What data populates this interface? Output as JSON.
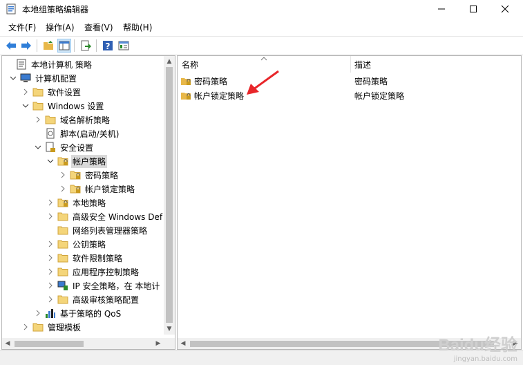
{
  "window": {
    "title": "本地组策略编辑器"
  },
  "menu": [
    "文件(F)",
    "操作(A)",
    "查看(V)",
    "帮助(H)"
  ],
  "toolbar": [
    "back-icon",
    "forward-icon",
    "up-folder-icon",
    "show-tree-icon",
    "export-icon",
    "help-icon",
    "properties-icon"
  ],
  "tree": [
    {
      "label": "本地计算机 策略",
      "icon": "policy-doc-icon",
      "arrow": ""
    },
    {
      "label": "计算机配置",
      "icon": "computer-icon",
      "arrow": "open"
    },
    {
      "label": "软件设置",
      "icon": "folder-icon",
      "arrow": "closed"
    },
    {
      "label": "Windows 设置",
      "icon": "folder-icon",
      "arrow": "open"
    },
    {
      "label": "域名解析策略",
      "icon": "folder-icon",
      "arrow": "closed"
    },
    {
      "label": "脚本(启动/关机)",
      "icon": "script-icon",
      "arrow": ""
    },
    {
      "label": "安全设置",
      "icon": "security-icon",
      "arrow": "open"
    },
    {
      "label": "帐户策略",
      "icon": "locked-folder-icon",
      "arrow": "open",
      "selected": true
    },
    {
      "label": "密码策略",
      "icon": "locked-folder-icon",
      "arrow": "closed"
    },
    {
      "label": "帐户锁定策略",
      "icon": "locked-folder-icon",
      "arrow": "closed"
    },
    {
      "label": "本地策略",
      "icon": "locked-folder-icon",
      "arrow": "closed"
    },
    {
      "label": "高级安全 Windows Def",
      "icon": "folder-icon",
      "arrow": "closed"
    },
    {
      "label": "网络列表管理器策略",
      "icon": "folder-icon",
      "arrow": ""
    },
    {
      "label": "公钥策略",
      "icon": "folder-icon",
      "arrow": "closed"
    },
    {
      "label": "软件限制策略",
      "icon": "folder-icon",
      "arrow": "closed"
    },
    {
      "label": "应用程序控制策略",
      "icon": "folder-icon",
      "arrow": "closed"
    },
    {
      "label": "IP 安全策略，在 本地计",
      "icon": "ipsec-icon",
      "arrow": "closed"
    },
    {
      "label": "高级审核策略配置",
      "icon": "folder-icon",
      "arrow": "closed"
    },
    {
      "label": "基于策略的 QoS",
      "icon": "qos-chart-icon",
      "arrow": "closed"
    },
    {
      "label": "管理模板",
      "icon": "folder-icon",
      "arrow": "closed"
    }
  ],
  "list": {
    "columns": [
      "名称",
      "描述"
    ],
    "rows": [
      {
        "name": "密码策略",
        "desc": "密码策略"
      },
      {
        "name": "帐户锁定策略",
        "desc": "帐户锁定策略"
      }
    ]
  },
  "watermark": {
    "brand": "Baidu经验",
    "url": "jingyan.baidu.com"
  },
  "colors": {
    "accent": "#1a6fc9",
    "folder": "#e8b84a",
    "arrow_annotation": "#e8262a"
  }
}
